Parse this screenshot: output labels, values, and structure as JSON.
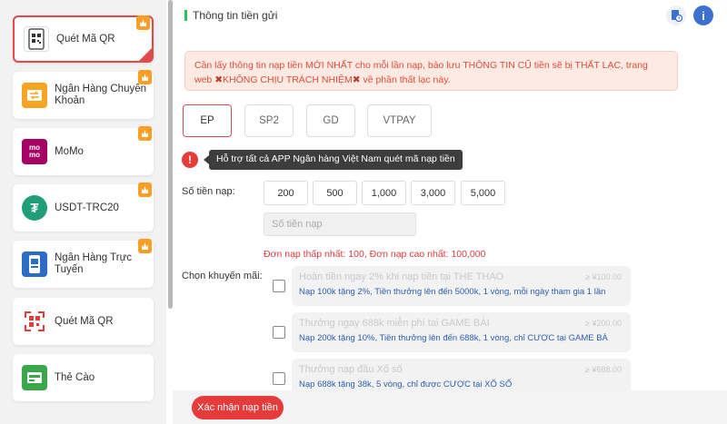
{
  "sidebar": {
    "items": [
      {
        "label": "Quét Mã QR",
        "icon": "qr-phone-icon",
        "active": true
      },
      {
        "label": "Ngân Hàng Chuyển Khoản",
        "icon": "bank-transfer-icon"
      },
      {
        "label": "MoMo",
        "icon": "momo-icon"
      },
      {
        "label": "USDT-TRC20",
        "icon": "usdt-icon"
      },
      {
        "label": "Ngân Hàng Trực Tuyến",
        "icon": "online-bank-icon"
      },
      {
        "label": "Quét Mã QR",
        "icon": "qr-code-icon"
      },
      {
        "label": "Thẻ Cào",
        "icon": "scratch-card-icon"
      }
    ]
  },
  "header": {
    "title": "Thông tin tiền gửi"
  },
  "notice": {
    "text_1": "Cần lấy thông tin nạp tiền MỚI NHẤT cho mỗi lần nạp, bảo lưu THÔNG TIN CŨ tiền sẽ bị THẤT LẠC, trang web ",
    "mark_1": "✖",
    "text_2": "KHÔNG CHỊU TRÁCH NHIỆM",
    "mark_2": "✖",
    "text_3": " về phần thất lạc này."
  },
  "gateways": [
    "EP",
    "SP2",
    "GD",
    "VTPAY"
  ],
  "info": {
    "warn_glyph": "!",
    "tooltip": "Hỗ trợ tất cả APP Ngân hàng Việt Nam quét mã nạp tiền"
  },
  "amount": {
    "label": "Số tiền nạp:",
    "presets": [
      "200",
      "500",
      "1,000",
      "3,000",
      "5,000"
    ],
    "placeholder": "Số tiền nạp",
    "min_label": "Đơn nạp thấp nhất:",
    "min_value": "100,",
    "max_label": "Đơn nạp cao nhất:",
    "max_value": "100,000"
  },
  "promotions": {
    "label": "Chọn khuyến mãi:",
    "items": [
      {
        "title": "Hoàn tiền ngay 2% khi nạp tiền tại THE THAO",
        "code": "≥ ¥100.00",
        "desc": "Nạp 100k tặng 2%, Tiền thưởng lên đến 5000k, 1 vòng, mỗi ngày tham gia 1 lần"
      },
      {
        "title": "Thưởng ngay 688k miễn phí tại GAME BÀI",
        "code": "≥ ¥200.00",
        "desc": "Nạp 200k tặng 10%, Tiền thưởng lên đến 688k, 1 vòng, chỉ CƯỢC tại GAME BÀ"
      },
      {
        "title": "Thưởng nạp đầu Xổ số",
        "code": "≥ ¥688.00",
        "desc": "Nạp 688k tặng 38k, 5 vòng, chỉ được CƯỢC tại XỔ SỐ"
      }
    ]
  },
  "confirm_label": "Xác nhận nạp tiền",
  "colors": {
    "accent": "#e53b3b",
    "badge": "#ff9d24",
    "header_bar": "#29c25a",
    "promo_desc": "#2b5fb3"
  }
}
